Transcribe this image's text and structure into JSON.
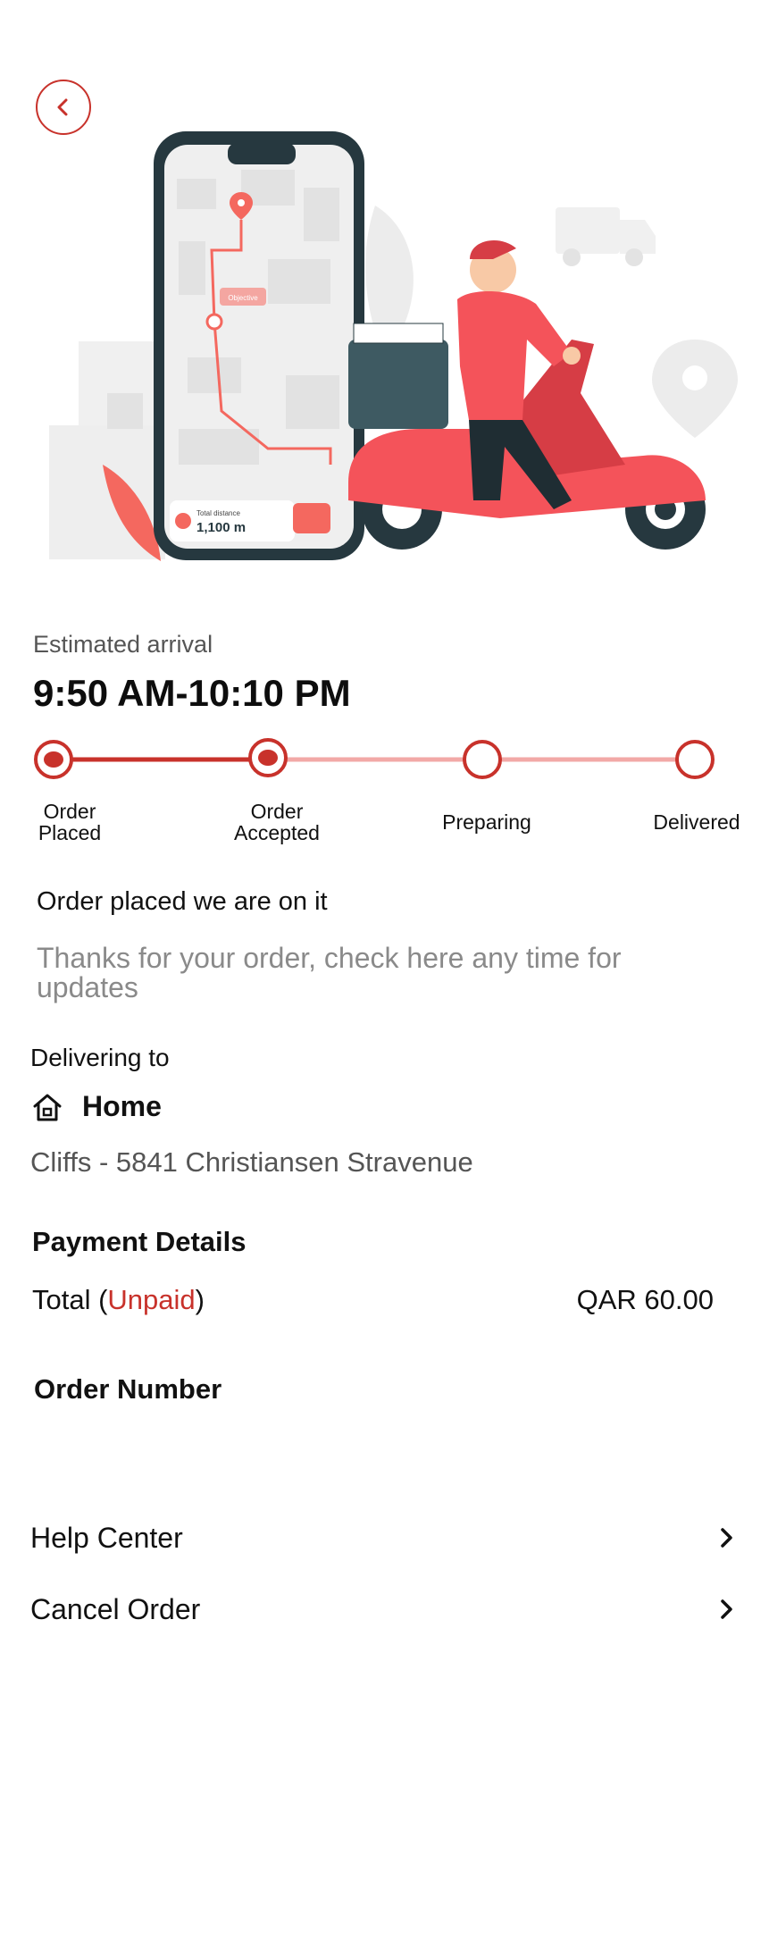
{
  "icons": {
    "back": "chevron-left-icon",
    "home": "home-icon",
    "chevron": "chevron-right-icon",
    "order_location_pin": "location-pin-icon",
    "distance": "total-distance-icon",
    "delivery_truck": "truck-icon"
  },
  "colors": {
    "accent": "#c8322b",
    "accent_light": "#f2a9a7",
    "muted_text": "#555555",
    "placeholder_text": "#8a8a8a"
  },
  "illustration": {
    "map_tag": "Objective",
    "distance_label": "Total distance",
    "distance_value": "1,100 m"
  },
  "eta": {
    "label": "Estimated arrival",
    "time": "9:50 AM-10:10 PM"
  },
  "progress": {
    "steps": [
      {
        "line1": "Order",
        "line2": "Placed",
        "state": "done"
      },
      {
        "line1": "Order",
        "line2": "Accepted",
        "state": "done"
      },
      {
        "line1": "Preparing",
        "line2": "",
        "state": "pending"
      },
      {
        "line1": "Delivered",
        "line2": "",
        "state": "pending"
      }
    ],
    "completed_steps": 2
  },
  "status": {
    "title": "Order placed we are on it",
    "subtitle": "Thanks for your order, check here any time for updates"
  },
  "delivery": {
    "label": "Delivering to",
    "place": "Home",
    "address": "Cliffs - 5841 Christiansen Stravenue"
  },
  "payment": {
    "title": "Payment Details",
    "total_prefix": "Total (",
    "status": "Unpaid",
    "total_suffix": ")",
    "amount": "QAR 60.00"
  },
  "order": {
    "title": "Order Number"
  },
  "links": {
    "help": "Help Center",
    "cancel": "Cancel Order"
  }
}
